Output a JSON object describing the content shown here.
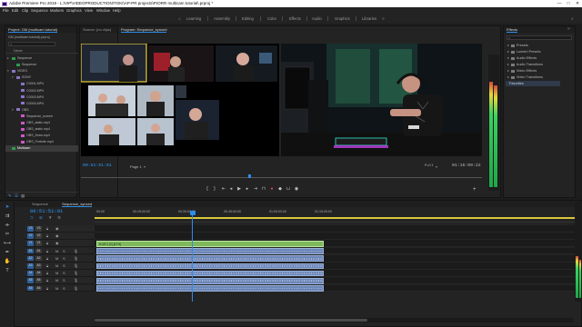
{
  "window": {
    "title": "Adobe Premiere Pro 2019 - L:\\VIP\\VIDEOPRODUCTION\\TOKI\\AP-PR projects\\PrORR multicam tutorial\\.prproj *",
    "controls": [
      "—",
      "□",
      "✕"
    ]
  },
  "menu": [
    "File",
    "Edit",
    "Clip",
    "Sequence",
    "Markers",
    "Graphics",
    "View",
    "Window",
    "Help"
  ],
  "workspaces": [
    "Learning",
    "Assembly",
    "Editing",
    "Color",
    "Effects",
    "Audio",
    "Graphics",
    "Libraries"
  ],
  "project": {
    "tab": "Project: GM (multicam tutorial)",
    "bin_name": "GM (multicam tutorial).prproj",
    "search_placeholder": "",
    "name_col": "Name",
    "items": [
      {
        "label": "Sequence",
        "level": 1,
        "color": "#2d9c4a",
        "tri": "▸"
      },
      {
        "label": "Sequence",
        "level": 2,
        "color": "#2d9c4a",
        "tri": ""
      },
      {
        "label": "VIDEO",
        "level": 1,
        "color": "#8c74c8",
        "tri": "▾"
      },
      {
        "label": "SONY",
        "level": 2,
        "color": "#8c74c8",
        "tri": "▾"
      },
      {
        "label": "C0001.MP4",
        "level": 3,
        "color": "#8c74c8",
        "tri": ""
      },
      {
        "label": "C0002.MP4",
        "level": 3,
        "color": "#8c74c8",
        "tri": ""
      },
      {
        "label": "C0003.MP4",
        "level": 3,
        "color": "#8c74c8",
        "tri": ""
      },
      {
        "label": "C0004.MP4",
        "level": 3,
        "color": "#8c74c8",
        "tri": ""
      },
      {
        "label": "OBS",
        "level": 2,
        "color": "#8c74c8",
        "tri": "▾"
      },
      {
        "label": "Sequence_screen",
        "level": 3,
        "color": "#d058c8",
        "tri": ""
      },
      {
        "label": "OBS_static.mp4",
        "level": 3,
        "color": "#d058c8",
        "tri": ""
      },
      {
        "label": "OBS_static.mp4",
        "level": 3,
        "color": "#d058c8",
        "tri": ""
      },
      {
        "label": "OBS_Draw.mp4",
        "level": 3,
        "color": "#d058c8",
        "tri": ""
      },
      {
        "label": "OBS_Fortnite.mp4",
        "level": 3,
        "color": "#d058c8",
        "tri": ""
      },
      {
        "label": "Multicam",
        "level": 1,
        "color": "#2d9c4a",
        "tri": "",
        "selected": true
      }
    ]
  },
  "source": {
    "tab": "Source: (no clips)",
    "timecode": "00:51:51:01",
    "page_label": "Page 1"
  },
  "program": {
    "tab": "Program: Sequence_synced",
    "fit_label": "Full",
    "timecode": "01:15:09:22"
  },
  "effects": {
    "tab": "Effects",
    "items": [
      "Presets",
      "Lumetri Presets",
      "Audio Effects",
      "Audio Transitions",
      "Video Effects",
      "Video Transitions"
    ],
    "highlighted_label": "Favorites"
  },
  "timeline": {
    "tabs": [
      "Sequence",
      "Sequence_synced"
    ],
    "timecode": "00:51:51:01",
    "ruler_ticks": [
      "00:00",
      "00:15:00:00",
      "00:30:00:00",
      "00:45:00:00",
      "01:00:00:00",
      "01:15:00:00"
    ],
    "video_tracks": [
      "V3",
      "V2",
      "V1"
    ],
    "audio_tracks": [
      "A1",
      "A2",
      "A3",
      "A4",
      "A5",
      "A6"
    ],
    "video_clip_label": "fx  MC1 [V]  [41%]",
    "playhead_fraction": 0.2
  },
  "colors": {
    "accent": "#2d8ceb",
    "video_clip": "#7fb85d",
    "audio_clip": "#6c86b6",
    "timecode": "#2e9bff"
  }
}
